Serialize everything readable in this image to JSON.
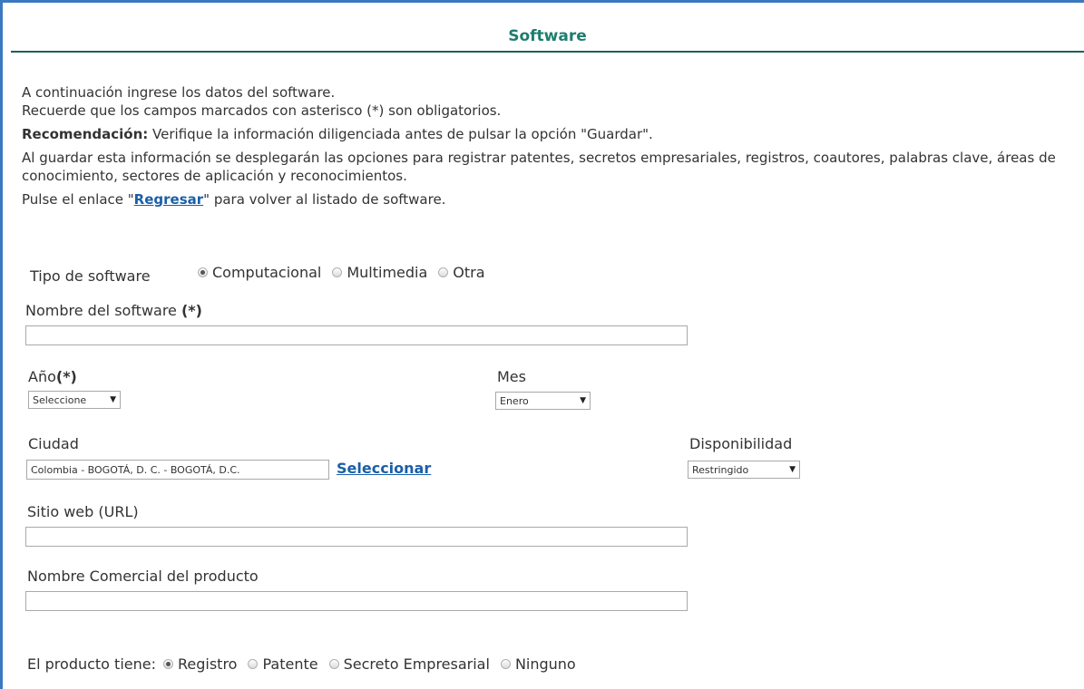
{
  "header": {
    "title": "Software"
  },
  "intro": {
    "line1": "A continuación ingrese los datos del software.",
    "line2": "Recuerde que los campos marcados con asterisco (*) son obligatorios.",
    "recommendation_label": "Recomendación:",
    "recommendation_text": " Verifique la información diligenciada antes de pulsar la opción \"Guardar\".",
    "line4": "Al guardar esta información se desplegarán las opciones para registrar patentes, secretos empresariales, registros, coautores, palabras clave, áreas de conocimiento, sectores de aplicación y reconocimientos.",
    "line5_before": "Pulse el enlace \"",
    "line5_link": "Regresar",
    "line5_after": "\" para volver al listado de software."
  },
  "form": {
    "tipo": {
      "label": "Tipo de software",
      "options": [
        "Computacional",
        "Multimedia",
        "Otra"
      ],
      "selected": "Computacional"
    },
    "nombre": {
      "label": "Nombre del software ",
      "required_mark": "(*)",
      "value": ""
    },
    "anio": {
      "label": "Año",
      "required_mark": "(*)",
      "value": "Seleccione"
    },
    "mes": {
      "label": "Mes",
      "value": "Enero"
    },
    "ciudad": {
      "label": "Ciudad",
      "value": "Colombia - BOGOTÁ, D. C. - BOGOTÁ, D.C.",
      "link": "Seleccionar"
    },
    "disponibilidad": {
      "label": "Disponibilidad",
      "value": "Restringido"
    },
    "sitio": {
      "label": "Sitio web (URL)",
      "value": ""
    },
    "comercial": {
      "label": "Nombre Comercial del producto",
      "value": ""
    },
    "producto": {
      "label": "El producto tiene:",
      "options": [
        "Registro",
        "Patente",
        "Secreto Empresarial",
        "Ninguno"
      ],
      "selected": "Registro"
    }
  },
  "icons": {
    "dropdown": "chevron-down-icon"
  },
  "colors": {
    "accent": "#1e7d6e",
    "link": "#1a5fa8",
    "frame": "#3a78c0"
  }
}
